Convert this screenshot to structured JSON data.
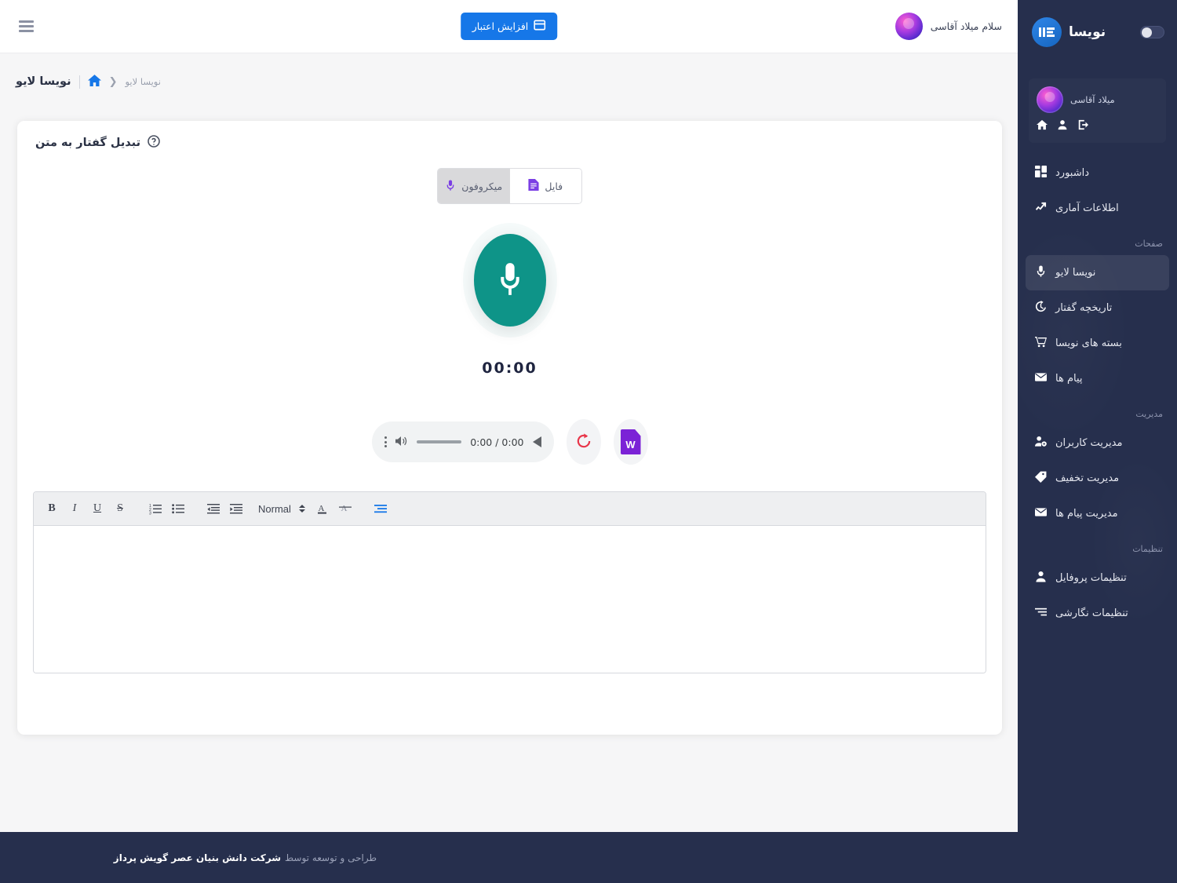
{
  "sidebar": {
    "brand_name": "نویسا",
    "brand_logo_icon": "nevisa-logo-icon",
    "theme_toggle_icon": "theme-toggle",
    "profile": {
      "name": "میلاد آقاسی",
      "icons": [
        "logout-icon",
        "user-icon",
        "home-icon"
      ]
    },
    "items": [
      {
        "label": "داشبورد",
        "icon": "dashboard-icon",
        "name": "dashboard",
        "active": false
      },
      {
        "label": "اطلاعات آماری",
        "icon": "analytics-icon",
        "name": "analytics",
        "active": false
      }
    ],
    "section_pages": "صفحات",
    "pages_items": [
      {
        "label": "نویسا لایو",
        "icon": "microphone-icon",
        "name": "nevisa-live",
        "active": true
      },
      {
        "label": "تاریخچه گفتار",
        "icon": "history-icon",
        "name": "speech-history",
        "active": false
      },
      {
        "label": "بسته های نویسا",
        "icon": "cart-icon",
        "name": "nevisa-packages",
        "active": false
      },
      {
        "label": "پیام ها",
        "icon": "mail-icon",
        "name": "messages",
        "active": false
      }
    ],
    "section_management": "مدیریت",
    "management_items": [
      {
        "label": "مدیریت کاربران",
        "icon": "users-manage-icon",
        "name": "manage-users",
        "active": false
      },
      {
        "label": "مدیریت تخفیف",
        "icon": "tag-icon",
        "name": "manage-discounts",
        "active": false
      },
      {
        "label": "مدیریت پیام ها",
        "icon": "mail-icon",
        "name": "manage-messages",
        "active": false
      }
    ],
    "section_settings": "تنظیمات",
    "settings_items": [
      {
        "label": "تنظیمات پروفایل",
        "icon": "user-icon",
        "name": "profile-settings",
        "active": false
      },
      {
        "label": "تنظیمات نگارشی",
        "icon": "text-settings-icon",
        "name": "writing-settings",
        "active": false
      }
    ]
  },
  "header": {
    "greeting": "سلام میلاد آقاسی",
    "avatar_icon": "user-avatar",
    "credit_button": "افزایش اعتبار",
    "credit_icon": "card-icon",
    "menu_icon": "hamburger-icon"
  },
  "breadcrumb": {
    "title": "نویسا لایو",
    "home_icon": "home-icon",
    "separator": "❮",
    "current": "نویسا لایو"
  },
  "main": {
    "card_title": "تبدیل گفتار به متن",
    "help_icon": "help-circle-icon",
    "tabs": [
      {
        "label": "میکروفون",
        "icon": "microphone-icon",
        "name": "tab-microphone",
        "active": true
      },
      {
        "label": "فایل",
        "icon": "file-icon",
        "name": "tab-file",
        "active": false
      }
    ],
    "record_button_icon": "microphone-icon",
    "record_button_color": "#0e9488",
    "timer": "00:00",
    "player": {
      "play_icon": "play-icon",
      "time": "0:00 / 0:00",
      "volume_icon": "volume-icon",
      "more_icon": "more-vertical-icon"
    },
    "reset_button_icon": "refresh-icon",
    "reset_color": "#e8364a",
    "export_button_icon": "word-document-icon",
    "export_color": "#7b22d6",
    "toolbar": {
      "bold": "B",
      "italic": "I",
      "underline": "U",
      "strike": "S",
      "ordered_list_icon": "ordered-list-icon",
      "bullet_list_icon": "bullet-list-icon",
      "outdent_icon": "outdent-icon",
      "indent_icon": "indent-icon",
      "format_label": "Normal",
      "color_icon": "text-color-icon",
      "clear_format_icon": "clear-format-icon",
      "align_icon": "align-right-icon",
      "align_color": "#1677e8"
    },
    "editor_text": ""
  },
  "footer": {
    "prefix": "طراحی و توسعه توسط",
    "company": "شرکت دانش بنیان عصر گویش پرداز"
  }
}
